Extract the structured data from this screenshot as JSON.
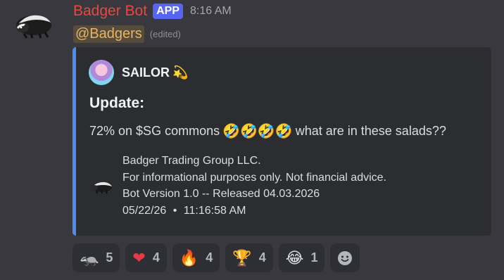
{
  "message": {
    "author": "Badger Bot",
    "app_badge": "APP",
    "timestamp": "8:16 AM",
    "mention": "@Badgers",
    "edited_label": "(edited)"
  },
  "embed": {
    "accent_color": "#4b8cf5",
    "author_name": "SAILOR",
    "author_suffix_icon": "dizzy-sparkle-icon",
    "title": "Update:",
    "description_before": "72% on $SG commons",
    "description_emojis": [
      "🤣",
      "🤣",
      "🤣",
      "🤣"
    ],
    "description_after": "what are in these salads??",
    "footer_lines": [
      "Badger Trading Group LLC.",
      "For informational purposes only. Not financial advice.",
      "Bot Version 1.0 -- Released 04.03.2026"
    ],
    "footer_date": "05/22/26",
    "footer_separator": "•",
    "footer_time": "11:16:58 AM"
  },
  "reactions": [
    {
      "icon": "badger-icon",
      "glyph": "🦡",
      "count": "5"
    },
    {
      "icon": "heart-icon",
      "glyph": "❤",
      "count": "4"
    },
    {
      "icon": "fire-icon",
      "glyph": "🔥",
      "count": "4"
    },
    {
      "icon": "trophy-icon",
      "glyph": "🏆",
      "count": "4"
    },
    {
      "icon": "joy-icon",
      "glyph": "😂",
      "count": "1"
    }
  ],
  "colors": {
    "background": "#38383e",
    "author_name": "#e9473f",
    "app_badge": "#5865f2",
    "mention": "#e9b465",
    "embed_bg": "#2b2d31"
  }
}
